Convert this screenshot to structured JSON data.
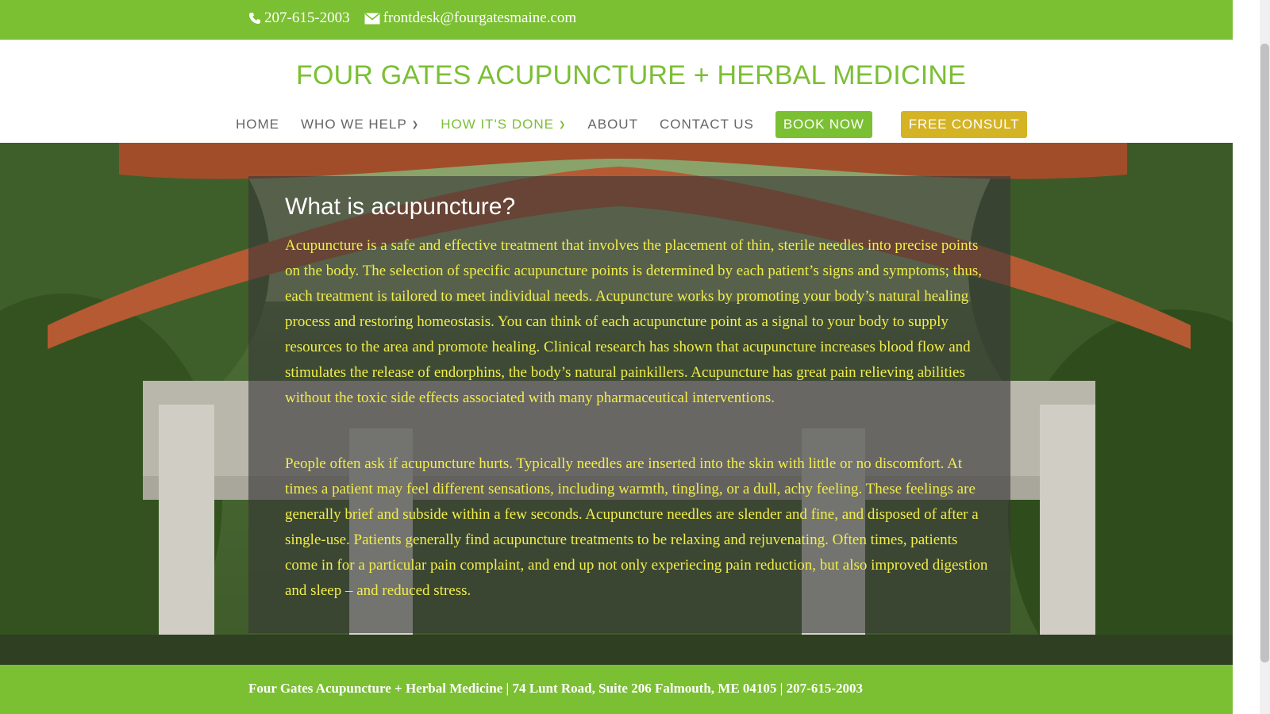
{
  "topbar": {
    "phone": "207-615-2003",
    "email": "frontdesk@fourgatesmaine.com"
  },
  "header": {
    "logo": "FOUR GATES ACUPUNCTURE + HERBAL MEDICINE"
  },
  "nav": {
    "home": "HOME",
    "who_we_help": "WHO WE HELP",
    "how_its_done": "HOW IT'S DONE",
    "about": "ABOUT",
    "contact": "CONTACT US",
    "book": "BOOK NOW",
    "consult": "FREE CONSULT"
  },
  "content": {
    "heading": "What is acupuncture?",
    "paragraph1": "Acupuncture is a safe and effective treatment that involves the placement of thin, sterile needles into precise points on the body. The selection of specific acupuncture points is determined by each patient’s signs and symptoms; thus, each treatment is tailored to meet individual needs. Acupuncture works by promoting your body’s natural healing process and restoring homeostasis. You can think of each acupuncture point as a signal to your body to supply resources to the area and promote healing. Clinical research has shown that acupuncture increases blood flow and stimulates the release of endorphins, the body’s natural painkillers. Acupuncture has great pain relieving abilities without the toxic side effects associated with many pharmaceutical interventions.",
    "paragraph2": "People often ask if acupuncture hurts.  Typically needles are inserted into the skin with little or no discomfort.  At times a patient may feel different sensations, including warmth, tingling, or a dull, achy feeling. These feelings are generally brief and subside within a few seconds.  Acupuncture needles are slender and fine, and disposed of after a single-use. Patients generally find acupuncture treatments to be relaxing and rejuvenating. Often times, patients come in for a particular pain complaint, and end up not only experiecing pain reduction, but also improved digestion and sleep – and reduced stress."
  },
  "footer": {
    "text": "Four Gates Acupuncture + Herbal Medicine | 74 Lunt Road, Suite 206 Falmouth, ME 04105 | 207-615-2003"
  },
  "icons": {
    "phone": "phone-icon",
    "email": "envelope-icon"
  },
  "colors": {
    "brand_green": "#7bbf33",
    "consult_gold": "#d4b325",
    "body_text_yellow": "#f1ee4a"
  }
}
